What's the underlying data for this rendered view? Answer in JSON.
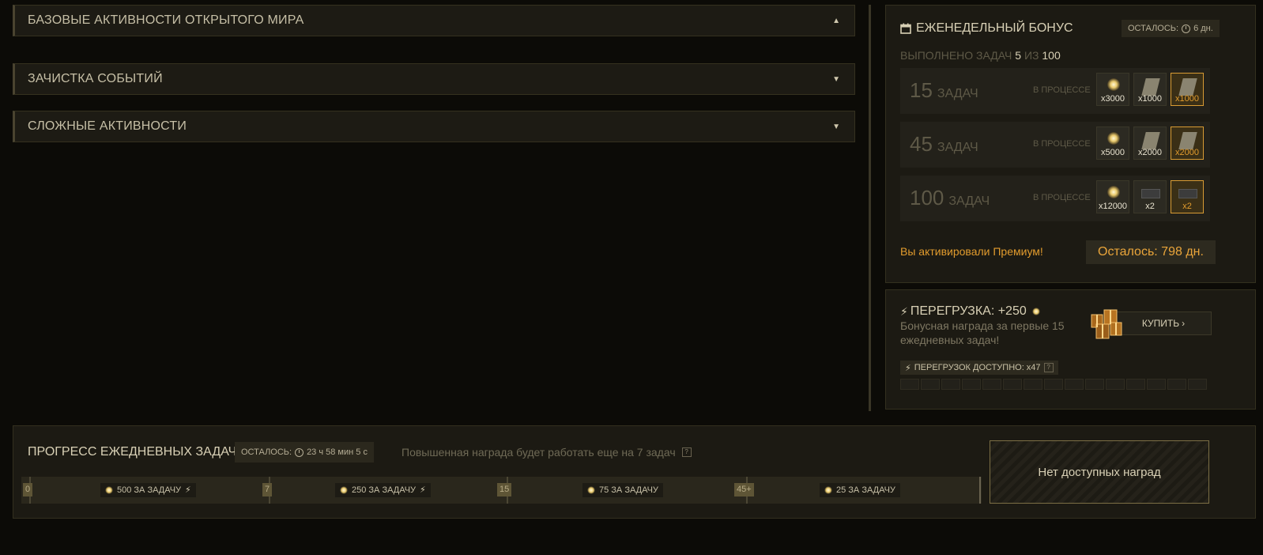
{
  "left": {
    "accordions": [
      {
        "title": "БАЗОВЫЕ АКТИВНОСТИ ОТКРЫТОГО МИРА",
        "arrow": "▲"
      },
      {
        "title": "ЗАЧИСТКА СОБЫТИЙ",
        "arrow": "▼"
      },
      {
        "title": "СЛОЖНЫЕ АКТИВНОСТИ",
        "arrow": "▼"
      }
    ]
  },
  "weekly": {
    "title": "ЕЖЕНЕДЕЛЬНЫЙ БОНУС",
    "remaining_label": "ОСТАЛОСЬ:",
    "remaining_value": "6 дн.",
    "done_label": "ВЫПОЛНЕНО ЗАДАЧ",
    "done_count": "5",
    "done_of": "ИЗ",
    "done_total": "100",
    "tiers": [
      {
        "num": "15",
        "label": "ЗАДАЧ",
        "status": "В ПРОЦЕССЕ",
        "rewards": [
          "x3000",
          "x1000",
          "x1000"
        ]
      },
      {
        "num": "45",
        "label": "ЗАДАЧ",
        "status": "В ПРОЦЕССЕ",
        "rewards": [
          "x5000",
          "x2000",
          "x2000"
        ]
      },
      {
        "num": "100",
        "label": "ЗАДАЧ",
        "status": "В ПРОЦЕССЕ",
        "rewards": [
          "x12000",
          "x2",
          "x2"
        ]
      }
    ],
    "premium_text": "Вы активировали Премиум!",
    "premium_left": "Осталось: 798 дн."
  },
  "overload": {
    "title": "ПЕРЕГРУЗКА: +250",
    "desc_line1": "Бонусная награда за первые 15",
    "desc_line2": "ежедневных задач!",
    "buy_label": "КУПИТЬ",
    "available_label": "ПЕРЕГРУЗОК ДОСТУПНО: x47",
    "help": "?",
    "segments": 15
  },
  "daily": {
    "title": "ПРОГРЕСС ЕЖЕДНЕВНЫХ ЗАДАЧ",
    "remaining_label": "ОСТАЛОСЬ:",
    "remaining_value": "23 ч 58 мин 5 с",
    "hint": "Повышенная награда будет работать еще на 7 задач",
    "help": "?",
    "marks": [
      "0",
      "7",
      "15",
      "45+"
    ],
    "rates": [
      "500 ЗА ЗАДАЧУ",
      "250 ЗА ЗАДАЧУ",
      "75 ЗА ЗАДАЧУ",
      "25 ЗА ЗАДАЧУ"
    ],
    "no_rewards": "Нет доступных наград"
  }
}
